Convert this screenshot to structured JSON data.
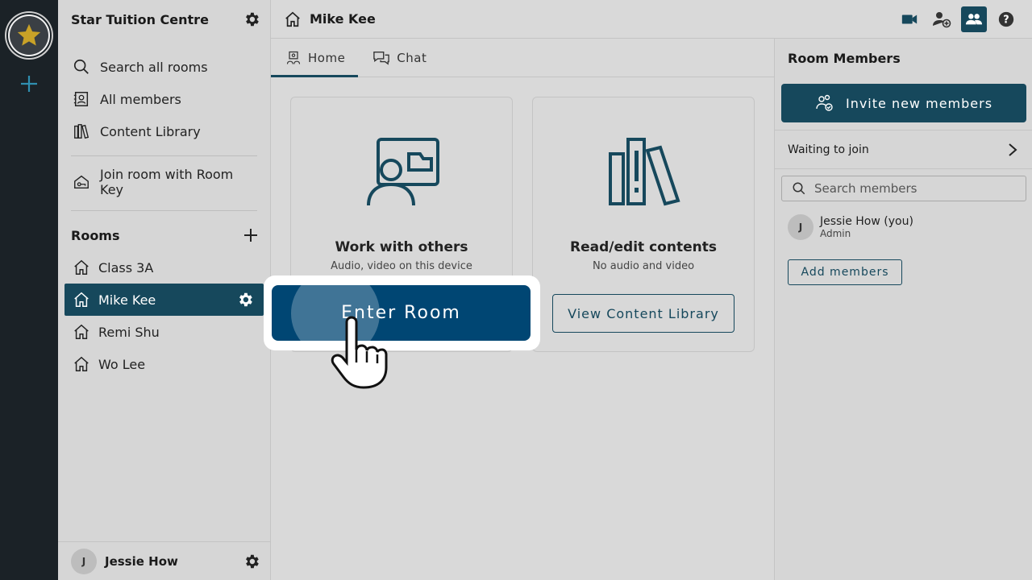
{
  "org": {
    "name": "Star Tuition Centre",
    "logo_icon": "star-logo-icon"
  },
  "sidebar": {
    "nav": [
      {
        "label": "Search all rooms",
        "icon": "search-icon"
      },
      {
        "label": "All members",
        "icon": "members-book-icon"
      },
      {
        "label": "Content Library",
        "icon": "library-icon"
      }
    ],
    "join_key_label": "Join room with Room Key",
    "rooms_heading": "Rooms",
    "rooms": [
      "Class 3A",
      "Mike Kee",
      "Remi Shu",
      "Wo Lee"
    ],
    "active_room": "Mike Kee"
  },
  "user": {
    "initial": "J",
    "name": "Jessie How"
  },
  "header": {
    "room_title": "Mike Kee"
  },
  "tabs": [
    {
      "label": "Home"
    },
    {
      "label": "Chat"
    }
  ],
  "cards": {
    "work": {
      "title": "Work with others",
      "subtitle": "Audio, video on this device",
      "button": "Enter Room"
    },
    "read": {
      "title": "Read/edit contents",
      "subtitle": "No audio and video",
      "button": "View Content Library"
    }
  },
  "right_panel": {
    "title": "Room Members",
    "invite_label": "Invite new members",
    "waiting_label": "Waiting to join",
    "search_placeholder": "Search members",
    "members": [
      {
        "initial": "J",
        "name": "Jessie How (you)",
        "role": "Admin"
      }
    ],
    "add_members_label": "Add members"
  },
  "colors": {
    "primary": "#16485c",
    "enter_button": "#004673",
    "rail": "#1b2227",
    "logo_gold": "#c9a227"
  }
}
